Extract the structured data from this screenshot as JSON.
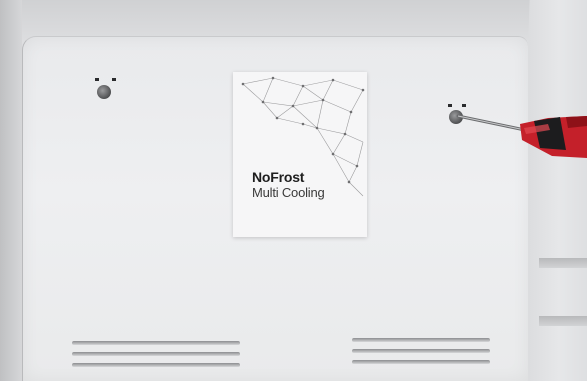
{
  "label": {
    "brand": "NoFrost",
    "tagline": "Multi Cooling"
  },
  "colors": {
    "panel": "#eeeff1",
    "handle_red": "#c4202a",
    "handle_dark": "#1c1c1e"
  }
}
